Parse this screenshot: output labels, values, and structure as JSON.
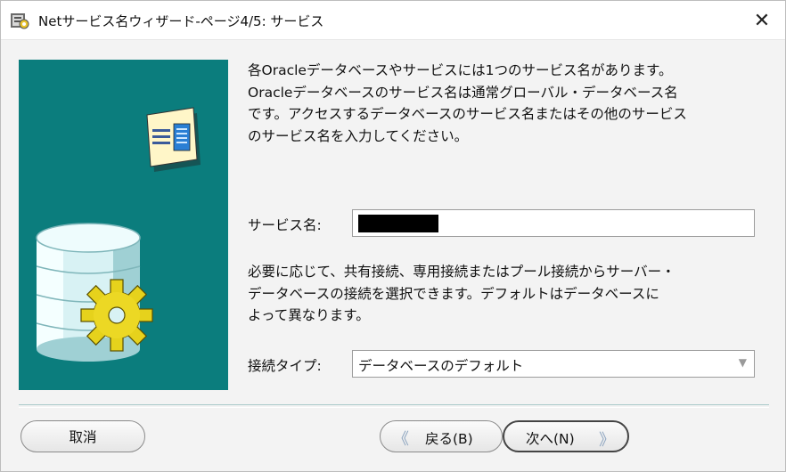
{
  "window": {
    "title": "Netサービス名ウィザード-ページ4/5: サービス",
    "close_glyph": "✕",
    "app_icon": "oracle-wizard-icon"
  },
  "main": {
    "description": "各Oracleデータベースやサービスには1つのサービス名があります。\nOracleデータベースのサービス名は通常グローバル・データベース名\nです。アクセスするデータベースのサービス名またはその他のサービス\nのサービス名を入力してください。",
    "service_name_label": "サービス名:",
    "service_name_value": "",
    "connection_description": "必要に応じて、共有接続、専用接続またはプール接続からサーバー・\nデータベースの接続を選択できます。デフォルトはデータベースに\nよって異なります。",
    "connection_type_label": "接続タイプ:",
    "connection_type_value": "データベースのデフォルト"
  },
  "footer": {
    "cancel_label": "取消",
    "back_label": "戻る(B)",
    "next_label": "次へ(N)"
  },
  "colors": {
    "illustration_bg": "#0b7d7d",
    "dialog_bg": "#f3f3f3"
  }
}
